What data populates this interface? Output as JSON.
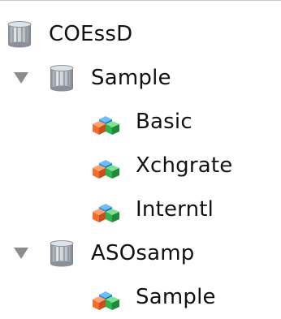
{
  "tree": {
    "items": [
      {
        "label": "COEssD",
        "icon": "database-server-icon",
        "expanded": null
      },
      {
        "label": "Sample",
        "icon": "database-application-icon",
        "expanded": true
      },
      {
        "label": "Basic",
        "icon": "cube-database-icon",
        "expanded": null
      },
      {
        "label": "Xchgrate",
        "icon": "cube-database-icon",
        "expanded": null
      },
      {
        "label": "Interntl",
        "icon": "cube-database-icon",
        "expanded": null
      },
      {
        "label": "ASOsamp",
        "icon": "database-application-icon",
        "expanded": true
      },
      {
        "label": "Sample",
        "icon": "cube-database-icon",
        "expanded": null
      }
    ]
  },
  "colors": {
    "disclosure_triangle": "#8d8d8d",
    "db_light": "#d9dde2",
    "db_dark": "#8e949b",
    "cube_orange": "#f36d2c",
    "cube_blue": "#2f8ee0",
    "cube_green": "#2eb54d"
  }
}
